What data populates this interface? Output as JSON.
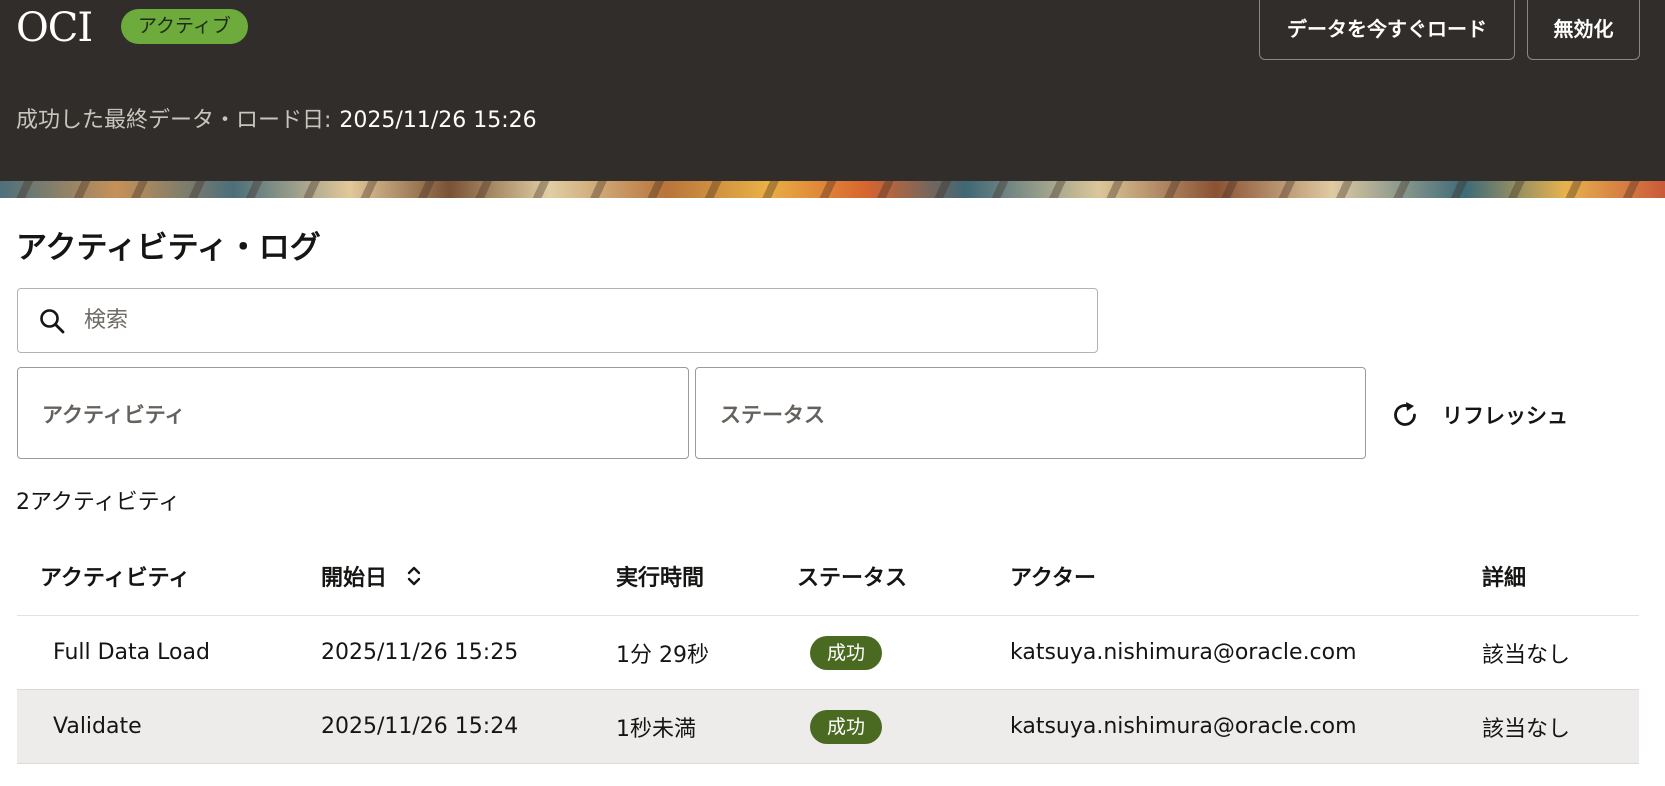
{
  "header": {
    "brand": "OCI",
    "status_badge": "アクティブ",
    "load_now_button": "データを今すぐロード",
    "disable_button": "無効化",
    "last_load_label": "成功した最終データ・ロード日:",
    "last_load_value": "2025/11/26 15:26"
  },
  "colors": {
    "header_bg": "#312d2a",
    "active_badge": "#6cab3c",
    "success_pill": "#4a6a22",
    "alt_row": "#edecea"
  },
  "activity_log": {
    "title": "アクティビティ・ログ",
    "search": {
      "placeholder": "検索",
      "value": "",
      "icon": "search-icon"
    },
    "filters": {
      "activity_label": "アクティビティ",
      "status_label": "ステータス"
    },
    "refresh": {
      "label": "リフレッシュ",
      "icon": "refresh-icon"
    },
    "count_text": "2アクティビティ",
    "columns": [
      "アクティビティ",
      "開始日",
      "実行時間",
      "ステータス",
      "アクター",
      "詳細"
    ],
    "rows": [
      {
        "activity": "Full Data Load",
        "start": "2025/11/26 15:25",
        "duration": "1分 29秒",
        "status": "成功",
        "actor": "katsuya.nishimura@oracle.com",
        "details": "該当なし"
      },
      {
        "activity": "Validate",
        "start": "2025/11/26 15:24",
        "duration": "1秒未満",
        "status": "成功",
        "actor": "katsuya.nishimura@oracle.com",
        "details": "該当なし"
      }
    ]
  }
}
